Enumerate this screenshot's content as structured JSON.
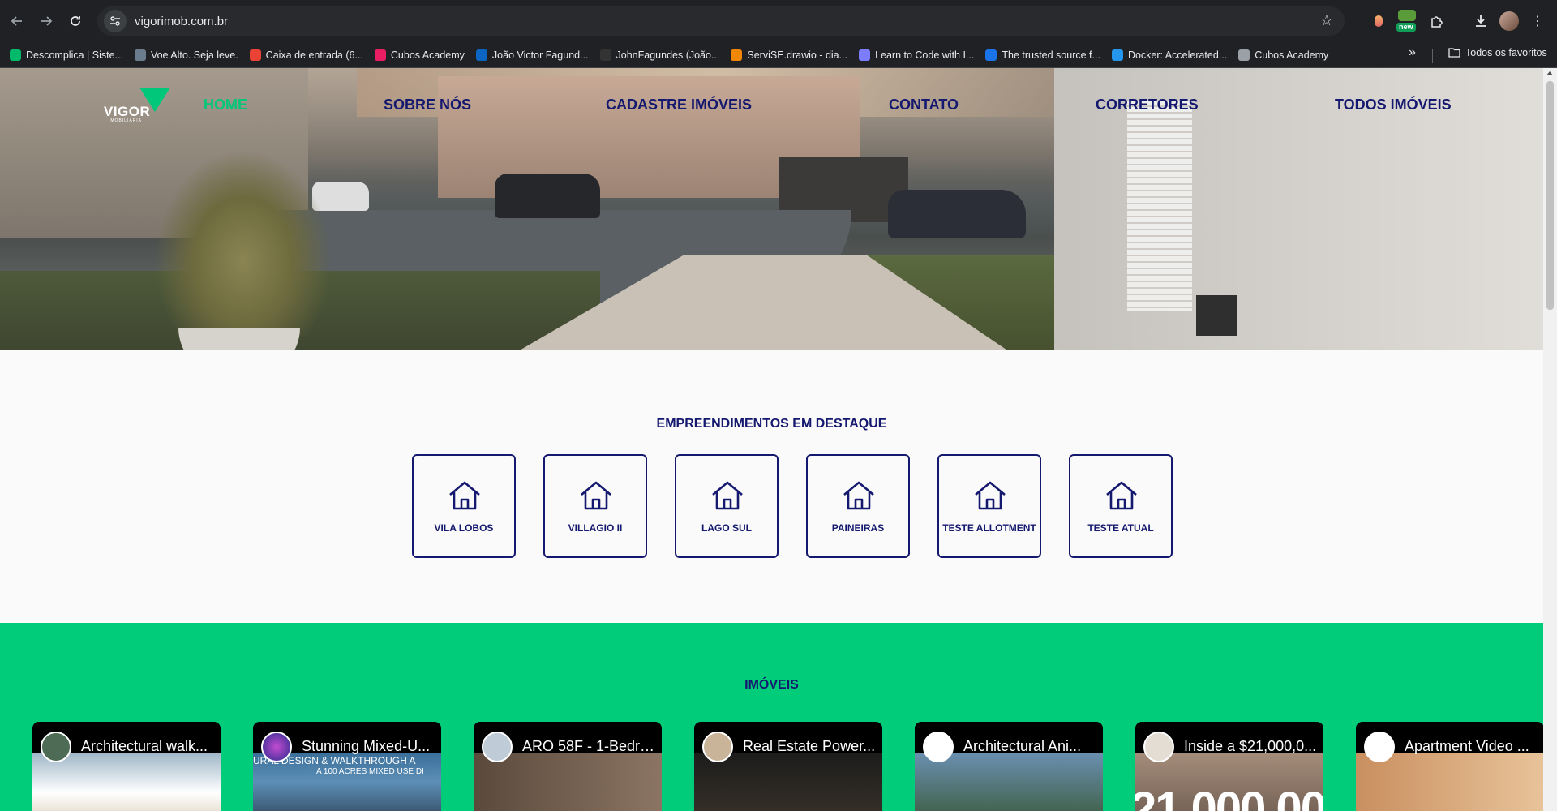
{
  "browser": {
    "url": "vigorimob.com.br",
    "new_badge": "new",
    "bookmarks": [
      {
        "label": "Descomplica | Siste...",
        "color": "#00b96b"
      },
      {
        "label": "Voe Alto. Seja leve.",
        "color": "#6b7c8f"
      },
      {
        "label": "Caixa de entrada (6...",
        "color": "#ea4335"
      },
      {
        "label": "Cubos Academy",
        "color": "#e91e63"
      },
      {
        "label": "João Victor Fagund...",
        "color": "#0a66c2"
      },
      {
        "label": "JohnFagundes (João...",
        "color": "#333333"
      },
      {
        "label": "ServiSE.drawio - dia...",
        "color": "#f08705"
      },
      {
        "label": "Learn to Code with I...",
        "color": "#7c7cff"
      },
      {
        "label": "The trusted source f...",
        "color": "#1a73e8"
      },
      {
        "label": "Docker: Accelerated...",
        "color": "#2496ed"
      },
      {
        "label": "Cubos Academy",
        "color": "#9aa0a6"
      }
    ],
    "all_bookmarks": "Todos os favoritos"
  },
  "site": {
    "logo_text": "VIGOR",
    "logo_sub": "IMOBILIÁRIA",
    "menu": [
      {
        "label": "HOME",
        "active": true
      },
      {
        "label": "SOBRE NÓS",
        "active": false
      },
      {
        "label": "CADASTRE IMÓVEIS",
        "active": false
      },
      {
        "label": "CONTATO",
        "active": false
      },
      {
        "label": "CORRETORES",
        "active": false
      },
      {
        "label": "TODOS IMÓVEIS",
        "active": false
      }
    ],
    "colors": {
      "primary": "#14186e",
      "accent": "#00c77a",
      "section_bg": "#00cc7a"
    }
  },
  "featured": {
    "title": "EMPREENDIMENTOS EM DESTAQUE",
    "items": [
      {
        "label": "VILA LOBOS",
        "icon": "house-icon"
      },
      {
        "label": "VILLAGIO II",
        "icon": "house-icon"
      },
      {
        "label": "LAGO SUL",
        "icon": "house-icon"
      },
      {
        "label": "PAINEIRAS",
        "icon": "house-icon"
      },
      {
        "label": "TESTE ALLOTMENT",
        "icon": "house-icon"
      },
      {
        "label": "TESTE ATUAL",
        "icon": "house-icon"
      }
    ]
  },
  "properties": {
    "title": "IMÓVEIS",
    "videos": [
      {
        "title": "Architectural walk..."
      },
      {
        "title": "Stunning Mixed-U...",
        "overlay": "URAL DESIGN & WALKTHROUGH A",
        "overlay2": "A 100 ACRES MIXED USE DI"
      },
      {
        "title": "ARO 58F - 1-Bedro..."
      },
      {
        "title": "Real Estate Power..."
      },
      {
        "title": "Architectural Ani..."
      },
      {
        "title": "Inside a $21,000,0...",
        "overlay": "21,000,00"
      },
      {
        "title": "Apartment Video ..."
      }
    ]
  }
}
